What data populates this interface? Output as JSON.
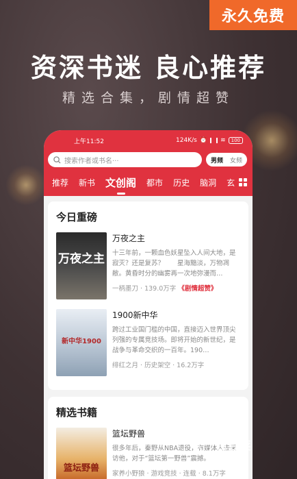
{
  "promo": {
    "badge": "永久免费",
    "headline": "资深书迷 良心推荐",
    "subline": "精选合集，剧情超赞"
  },
  "status_bar": {
    "time": "上午11:52",
    "speed": "124K/s",
    "battery": "100"
  },
  "search": {
    "placeholder": "搜索作者或书名···",
    "toggle": [
      "男频",
      "女频"
    ],
    "toggle_selected": "男频"
  },
  "tabs": [
    "推荐",
    "新书",
    "文创阁",
    "都市",
    "历史",
    "脑洞",
    "玄"
  ],
  "active_tab": "文创阁",
  "sections": [
    {
      "title": "今日重磅",
      "books": [
        {
          "cover_text": "万夜之主",
          "title": "万夜之主",
          "desc": "十三年前，一颗血色妖星坠入人间大地，是寂灭？还是复苏？　　星海黯淡，万物凋敝。黄昏时分的幽雾再一次地弥漫而…",
          "author": "一柄墨刀",
          "words": "139.0万字",
          "tag": "《剧情超赞》"
        },
        {
          "cover_text": "新中华1900",
          "title": "1900新中华",
          "desc": "跨过工业国门槛的中国，直接迈入世界顶尖列强的专属竞技场。即将开始的新世纪，是战争与革命交织的一百年。190…",
          "author": "绯红之月",
          "category": "历史架空",
          "words": "16.2万字"
        }
      ]
    },
    {
      "title": "精选书籍",
      "books": [
        {
          "cover_text": "篮坛野兽",
          "title": "篮坛野兽",
          "desc": "很多年后，秦野从NBA退役，有媒体人去采访他，对于“篮坛第一野兽”震撼。",
          "author": "家养小野狼",
          "category": "游戏竞技",
          "status": "连载",
          "words": "8.1万字"
        }
      ]
    }
  ],
  "watermark": "百豆荚"
}
